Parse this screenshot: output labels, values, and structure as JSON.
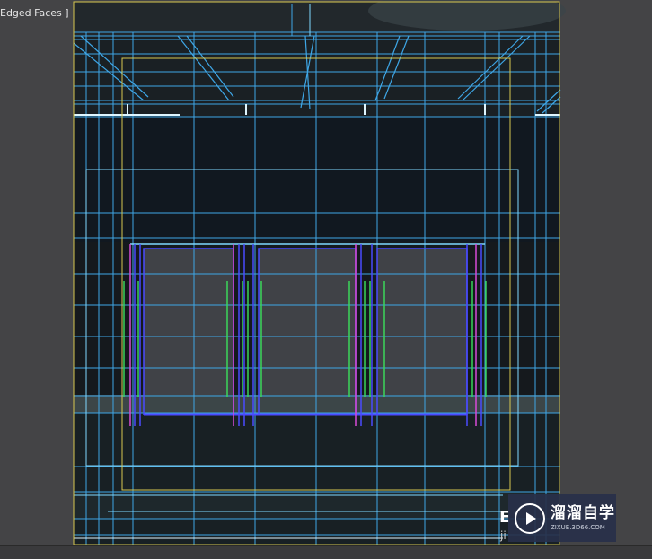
{
  "viewport": {
    "label": "Edged Faces ]",
    "shading_mode": "Edged Faces"
  },
  "colors": {
    "background": "#444446",
    "scene_dark": "#15191d",
    "wireframe_blue": "#3ea6e6",
    "wireframe_cyan": "#7fd8ff",
    "wireframe_yellow": "#d8c850",
    "door_green": "#3ad65a",
    "door_magenta": "#d84ad8",
    "door_blue": "#4a4aff",
    "watermark_bg": "#28304a"
  },
  "watermark": {
    "brand_text": "溜溜自学",
    "url_text": "ZIXUE.3D66.COM",
    "icon": "play-circle-icon"
  },
  "overlap_text": {
    "partial_glyph": "E",
    "partial_letters": "ji"
  }
}
